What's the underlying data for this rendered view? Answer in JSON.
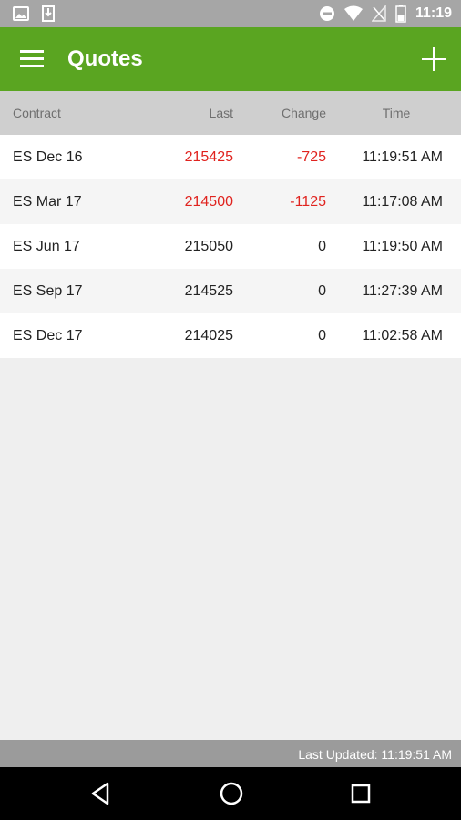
{
  "status_bar": {
    "time": "11:19"
  },
  "app_bar": {
    "title": "Quotes"
  },
  "table": {
    "headers": {
      "contract": "Contract",
      "last": "Last",
      "change": "Change",
      "time": "Time"
    },
    "rows": [
      {
        "contract": "ES Dec 16",
        "last": "215425",
        "change": "-725",
        "time": "11:19:51 AM",
        "negative": true
      },
      {
        "contract": "ES Mar 17",
        "last": "214500",
        "change": "-1125",
        "time": "11:17:08 AM",
        "negative": true
      },
      {
        "contract": "ES Jun 17",
        "last": "215050",
        "change": "0",
        "time": "11:19:50 AM",
        "negative": false
      },
      {
        "contract": "ES Sep 17",
        "last": "214525",
        "change": "0",
        "time": "11:27:39 AM",
        "negative": false
      },
      {
        "contract": "ES Dec 17",
        "last": "214025",
        "change": "0",
        "time": "11:02:58 AM",
        "negative": false
      }
    ]
  },
  "footer": {
    "last_updated": "Last Updated: 11:19:51 AM"
  },
  "colors": {
    "app_bar": "#5aa521",
    "negative": "#e0231f"
  },
  "icons": {
    "status_left": [
      "image-icon",
      "download-icon"
    ],
    "status_right": [
      "do-not-disturb-icon",
      "wifi-icon",
      "no-signal-icon",
      "battery-icon"
    ],
    "app_bar": [
      "menu-icon",
      "add-icon"
    ],
    "nav": [
      "back-icon",
      "home-icon",
      "recents-icon"
    ]
  }
}
